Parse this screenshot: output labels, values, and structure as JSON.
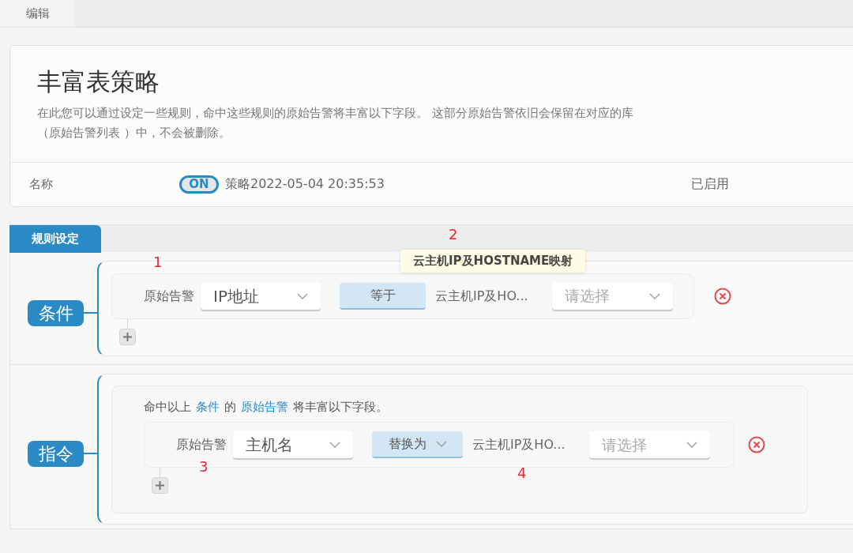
{
  "tabs": [
    {
      "label": "编辑",
      "selected": true
    }
  ],
  "header": {
    "title": "丰富表策略",
    "description": "在此您可以通过设定一些规则，命中这些规则的原始告警将丰富以下字段。 这部分原始告警依旧会保留在对应的库（原始告警列表 ）中，不会被删除。"
  },
  "name_row": {
    "label": "名称",
    "toggle": {
      "label": "ON",
      "on": true
    },
    "value": "策略2022-05-04 20:35:53",
    "status": "已启用"
  },
  "rules_tab": {
    "label": "规则设定",
    "selected": true
  },
  "condition": {
    "label": "条件",
    "row": {
      "field": "原始告警",
      "select": "IP地址",
      "operator": "等于",
      "value": "云主机IP及HO...",
      "target_placeholder": "请选择"
    },
    "tooltip": "云主机IP及HOSTNAME映射"
  },
  "instruction": {
    "label": "指令",
    "sentence": [
      {
        "kind": "plain",
        "text": "命中以上"
      },
      {
        "kind": "link",
        "text": "条件"
      },
      {
        "kind": "plain",
        "text": "的"
      },
      {
        "kind": "link",
        "text": "原始告警"
      },
      {
        "kind": "plain",
        "text": "将丰富以下字段。"
      }
    ],
    "row": {
      "field": "原始告警",
      "select": "主机名",
      "operator": "替换为",
      "value": "云主机IP及HO...",
      "target_placeholder": "请选择"
    }
  },
  "annotations": [
    "1",
    "2",
    "3",
    "4"
  ]
}
